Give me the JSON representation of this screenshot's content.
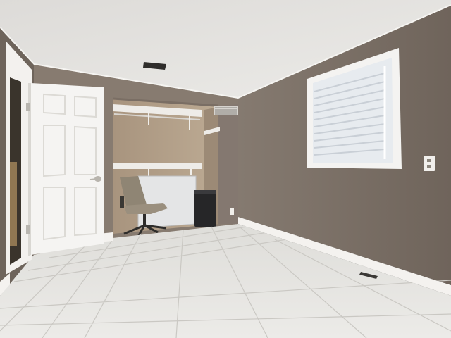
{
  "scene": {
    "colors": {
      "ceiling": "#e6e4e1",
      "wall_right": "#7d7065",
      "wall_back": "#857a70",
      "wall_left": "#6f655c",
      "closet_interior": "#b7a38c",
      "trim_white": "#f3f1ee",
      "floor_tile": "#e7e6e3",
      "grout": "#cfcdc9",
      "door": "#f4f3f0",
      "shutter": "#f7f7f6",
      "window_light": "#e9eef3",
      "chair": "#8d8373",
      "heater": "#2a2a2c"
    }
  }
}
